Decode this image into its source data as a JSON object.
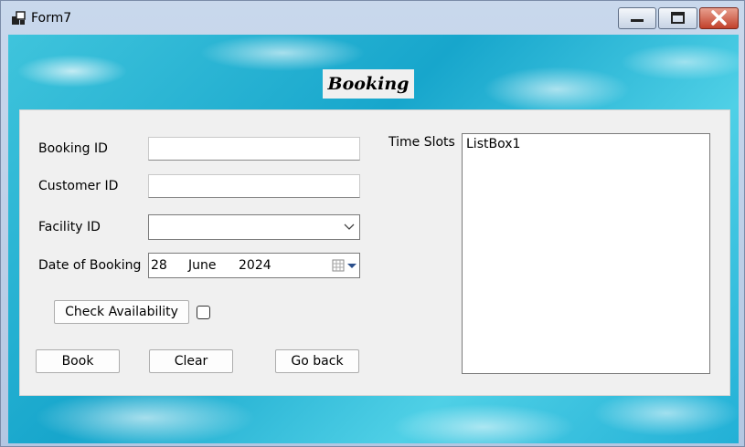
{
  "window": {
    "title": "Form7"
  },
  "heading": "Booking",
  "form": {
    "booking_id_label": "Booking ID",
    "booking_id_value": "",
    "customer_id_label": "Customer ID",
    "customer_id_value": "",
    "facility_id_label": "Facility ID",
    "facility_id_value": "",
    "date_label": "Date of Booking",
    "date": {
      "day": "28",
      "month": "June",
      "year": "2024"
    },
    "check_availability_label": "Check Availability",
    "availability_checked": false
  },
  "buttons": {
    "book": "Book",
    "clear": "Clear",
    "go_back": "Go back"
  },
  "time_slots": {
    "label": "Time Slots",
    "items": [
      "ListBox1"
    ]
  },
  "icons": [
    "app-icon",
    "minimize-icon",
    "maximize-icon",
    "close-icon",
    "chevron-down-icon",
    "calendar-icon"
  ]
}
